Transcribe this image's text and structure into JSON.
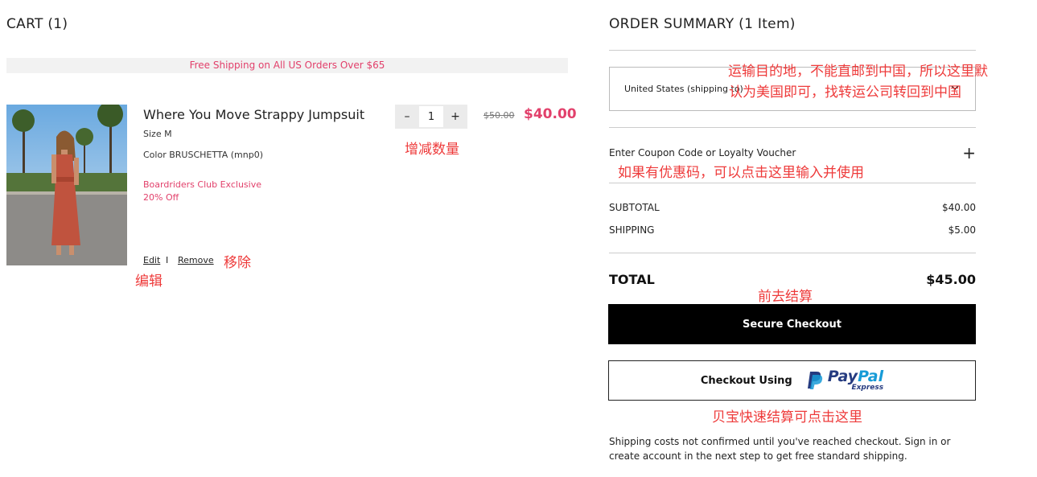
{
  "cart": {
    "title": "CART (1)",
    "banner": "Free Shipping on All US Orders Over $65",
    "item": {
      "name": "Where You Move Strappy Jumpsuit",
      "size": "Size M",
      "color": "Color BRUSCHETTA (mnp0)",
      "promo_line1": "Boardriders Club Exclusive",
      "promo_line2": "20% Off",
      "qty_minus": "–",
      "qty": "1",
      "qty_plus": "+",
      "old_price": "$50.00",
      "price": "$40.00",
      "edit": "Edit",
      "separator": "I",
      "remove": "Remove"
    }
  },
  "summary": {
    "title": "ORDER SUMMARY (1 Item)",
    "country": "United States (shipping to)",
    "coupon_label": "Enter Coupon Code or Loyalty Voucher",
    "coupon_plus": "+",
    "subtotal_label": "SUBTOTAL",
    "subtotal_value": "$40.00",
    "shipping_label": "SHIPPING",
    "shipping_value": "$5.00",
    "total_label": "TOTAL",
    "total_value": "$45.00",
    "checkout": "Secure Checkout",
    "paypal_label": "Checkout Using",
    "paypal_pay": "Pay",
    "paypal_pal": "Pal",
    "paypal_express": "Express",
    "note": "Shipping costs not confirmed until you've reached checkout. Sign in or create account in the next step to get free standard shipping."
  },
  "annotations": {
    "country_line1": "运输目的地，不能直邮到中国，所以这里默",
    "country_line2": "认为美国即可，找转运公司转回到中国",
    "qty": "增减数量",
    "coupon": "如果有优惠码，可以点击这里输入并使用",
    "remove": "移除",
    "edit": "编辑",
    "checkout": "前去结算",
    "paypal": "贝宝快速结算可点击这里"
  },
  "colors": {
    "accent": "#e2406b",
    "annotation": "#ee3b3b",
    "paypal_dark": "#253b80",
    "paypal_light": "#179bd7"
  }
}
